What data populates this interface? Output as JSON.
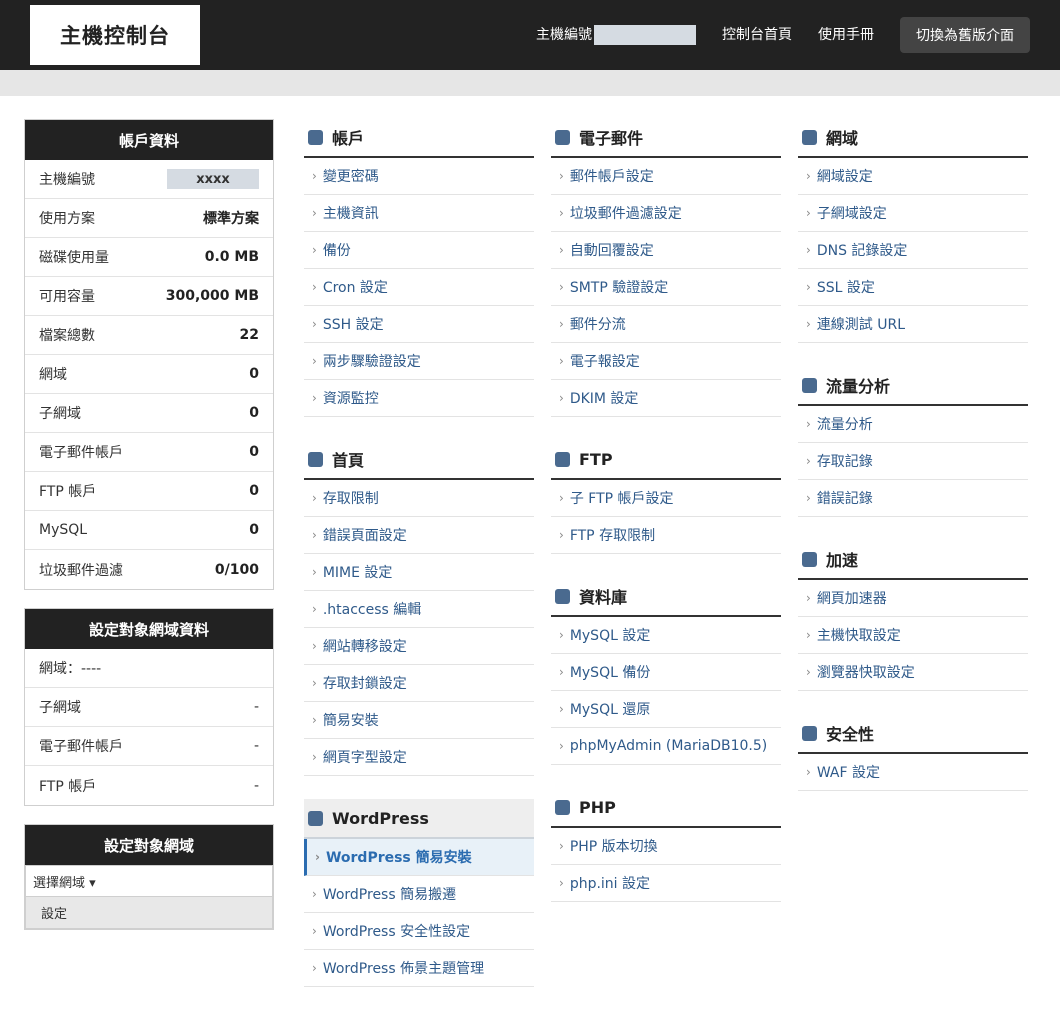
{
  "header": {
    "logo": "主機控制台",
    "host_label": "主機編號",
    "links": [
      "控制台首頁",
      "使用手冊"
    ],
    "switch_button": "切換為舊版介面"
  },
  "account_panel": {
    "title": "帳戶資料",
    "rows": [
      {
        "label": "主機編號",
        "value": "xxxx"
      },
      {
        "label": "使用方案",
        "value": "標準方案"
      },
      {
        "label": "磁碟使用量",
        "value": "0.0 MB"
      },
      {
        "label": "可用容量",
        "value": "300,000 MB"
      },
      {
        "label": "檔案總數",
        "value": "22"
      },
      {
        "label": "網域",
        "value": "0"
      },
      {
        "label": "子網域",
        "value": "0"
      },
      {
        "label": "電子郵件帳戶",
        "value": "0"
      },
      {
        "label": "FTP 帳戶",
        "value": "0"
      },
      {
        "label": "MySQL",
        "value": "0"
      },
      {
        "label": "垃圾郵件過濾",
        "value": "0/100"
      }
    ]
  },
  "domain_panel": {
    "title": "設定對象網域資料",
    "domain_line": "網域：----",
    "rows": [
      {
        "label": "子網域",
        "value": "-"
      },
      {
        "label": "電子郵件帳戶",
        "value": "-"
      },
      {
        "label": "FTP 帳戶",
        "value": "-"
      }
    ]
  },
  "target_panel": {
    "title": "設定對象網域",
    "select_label": "選擇網域 ▾",
    "set_button": "設定"
  },
  "sections": {
    "account": {
      "title": "帳戶",
      "items": [
        "變更密碼",
        "主機資訊",
        "備份",
        "Cron 設定",
        "SSH 設定",
        "兩步驟驗證設定",
        "資源監控"
      ]
    },
    "home": {
      "title": "首頁",
      "items": [
        "存取限制",
        "錯誤頁面設定",
        "MIME 設定",
        ".htaccess 編輯",
        "網站轉移設定",
        "存取封鎖設定",
        "簡易安裝",
        "網頁字型設定"
      ]
    },
    "wordpress": {
      "title": "WordPress",
      "items": [
        "WordPress 簡易安裝",
        "WordPress 簡易搬遷",
        "WordPress 安全性設定",
        "WordPress 佈景主題管理"
      ]
    },
    "email": {
      "title": "電子郵件",
      "items": [
        "郵件帳戶設定",
        "垃圾郵件過濾設定",
        "自動回覆設定",
        "SMTP 驗證設定",
        "郵件分流",
        "電子報設定",
        "DKIM 設定"
      ]
    },
    "ftp": {
      "title": "FTP",
      "items": [
        "子 FTP 帳戶設定",
        "FTP 存取限制"
      ]
    },
    "database": {
      "title": "資料庫",
      "items": [
        "MySQL 設定",
        "MySQL 備份",
        "MySQL 還原",
        "phpMyAdmin (MariaDB10.5)"
      ]
    },
    "php": {
      "title": "PHP",
      "items": [
        "PHP 版本切換",
        "php.ini 設定"
      ]
    },
    "domain": {
      "title": "網域",
      "items": [
        "網域設定",
        "子網域設定",
        "DNS 記錄設定",
        "SSL 設定",
        "連線測試 URL"
      ]
    },
    "traffic": {
      "title": "流量分析",
      "items": [
        "流量分析",
        "存取記錄",
        "錯誤記錄"
      ]
    },
    "speed": {
      "title": "加速",
      "items": [
        "網頁加速器",
        "主機快取設定",
        "瀏覽器快取設定"
      ]
    },
    "security": {
      "title": "安全性",
      "items": [
        "WAF 設定"
      ]
    }
  },
  "colors": {
    "header_bg": "#222222",
    "accent": "#4a6a8f",
    "link": "#2f5a8a",
    "active": "#2b6cb0"
  }
}
